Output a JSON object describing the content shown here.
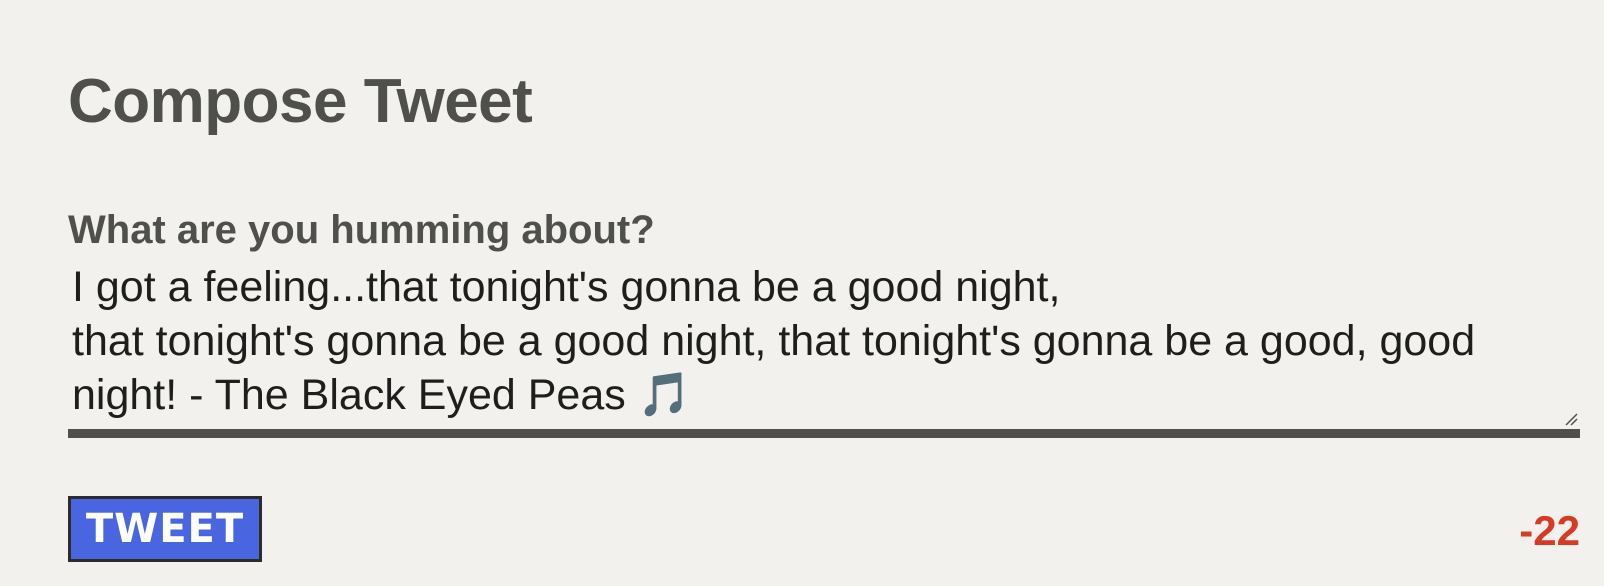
{
  "page": {
    "title": "Compose Tweet"
  },
  "compose": {
    "label": "What are you humming about?",
    "text": "I got a feeling...that tonight's gonna be a good night,\nthat tonight's gonna be a good night, that tonight's gonna be a good, good night! - The Black Eyed Peas 🎵",
    "submit_label": "TWEET",
    "char_count": "-22",
    "char_count_color": "#d93a26",
    "button_color": "#4965e0",
    "resize_icon": "resize-grip"
  }
}
